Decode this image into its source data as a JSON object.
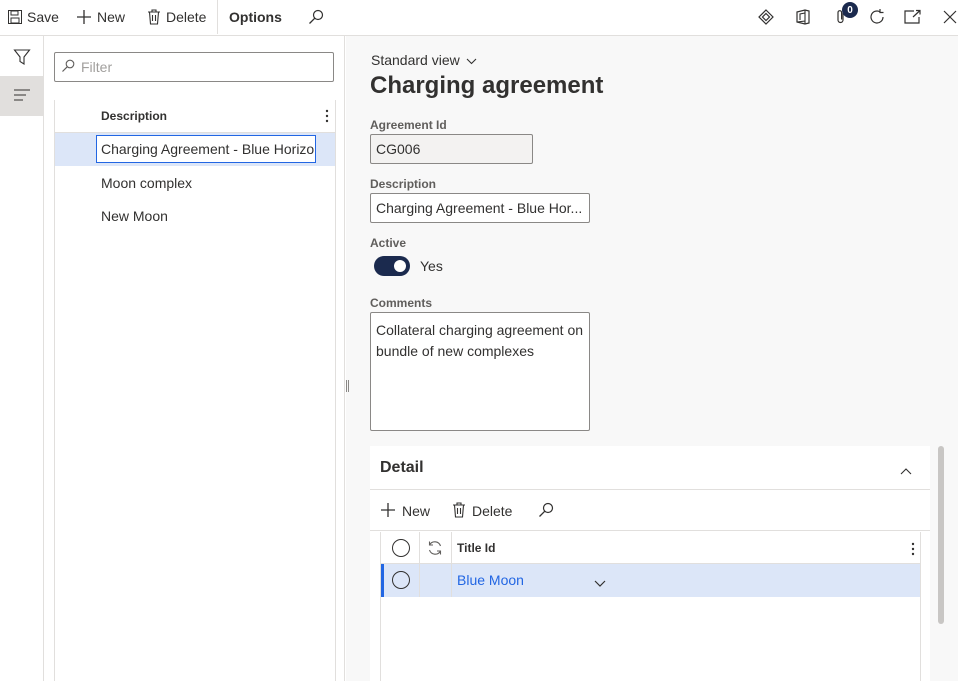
{
  "toolbar": {
    "save_label": "Save",
    "new_label": "New",
    "delete_label": "Delete",
    "options_label": "Options",
    "attachments_count": "0"
  },
  "list": {
    "filter_placeholder": "Filter",
    "column_header": "Description",
    "rows": [
      {
        "label": "Charging Agreement - Blue Horizo",
        "selected": true
      },
      {
        "label": "Moon complex"
      },
      {
        "label": "New Moon"
      }
    ]
  },
  "details": {
    "view_selector": "Standard view",
    "title": "Charging agreement",
    "agreement_id_label": "Agreement Id",
    "agreement_id_value": "CG006",
    "description_label": "Description",
    "description_value": "Charging Agreement - Blue Hor...",
    "active_label": "Active",
    "active_value": "Yes",
    "comments_label": "Comments",
    "comments_value": "Collateral charging agreement on bundle of new complexes"
  },
  "detail_section": {
    "heading": "Detail",
    "new_label": "New",
    "delete_label": "Delete",
    "column_title_id": "Title Id",
    "rows": [
      {
        "title_id": "Blue Moon"
      }
    ]
  },
  "colors": {
    "accent": "#2266e3",
    "toggle_on": "#1b2a4e",
    "selected_row": "#dce6f8"
  }
}
